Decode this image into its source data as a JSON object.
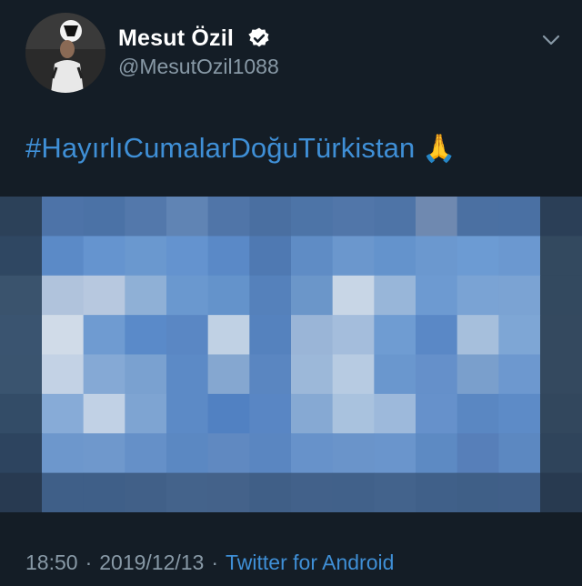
{
  "user": {
    "display_name": "Mesut Özil",
    "handle": "@MesutOzil1088",
    "verified": true
  },
  "tweet": {
    "hashtag": "#HayırlıCumalarDoğuTürkistan",
    "emoji": "🙏"
  },
  "meta": {
    "time": "18:50",
    "separator": "·",
    "date": "2019/12/13",
    "source": "Twitter for Android"
  },
  "icons": {
    "verified": "verified-badge-icon",
    "menu": "chevron-down-icon",
    "emoji": "folded-hands-icon"
  },
  "colors": {
    "background": "#141d26",
    "link": "#3f8fd6",
    "secondary_text": "#8899a6",
    "primary_text": "#ffffff"
  },
  "media": {
    "pixels": [
      [
        "#2c4159",
        "#4d73a8",
        "#4b72a6",
        "#5378ab",
        "#6084b4",
        "#5075a8",
        "#4a6fa1",
        "#4d74a7",
        "#5176a9",
        "#4e74a7",
        "#6f89b0",
        "#4b70a2",
        "#4a70a3",
        "#2b3f57"
      ],
      [
        "#2f4762",
        "#5b8ac7",
        "#6594cf",
        "#6a98cf",
        "#6493cf",
        "#5a89c7",
        "#4f79b2",
        "#5f8cc5",
        "#6b97cd",
        "#6493cc",
        "#6b98cf",
        "#6c9bd3",
        "#6b98d0",
        "#33495f"
      ],
      [
        "#3a536d",
        "#b0c3dc",
        "#b7c8df",
        "#8fb0d6",
        "#6a98cf",
        "#6493cb",
        "#5581bb",
        "#6b96c9",
        "#c8d6e6",
        "#98b6d9",
        "#6d9ad1",
        "#7aa3d4",
        "#7ba3d3",
        "#33495f"
      ],
      [
        "#3a5470",
        "#d0dbe8",
        "#6f9bd1",
        "#5a8ac9",
        "#5a87c4",
        "#c0d1e4",
        "#5582be",
        "#9ab5d7",
        "#a4bddc",
        "#6f9cd2",
        "#5a88c6",
        "#a6bfdc",
        "#7ea6d5",
        "#34495f"
      ],
      [
        "#3a546f",
        "#c3d2e5",
        "#85a9d5",
        "#7aa1d0",
        "#5c8ac6",
        "#85a7d0",
        "#5a86c1",
        "#9cb8d9",
        "#b7cbe2",
        "#6a97ce",
        "#6590ca",
        "#7a9fcc",
        "#6d98cf",
        "#34495f"
      ],
      [
        "#334c67",
        "#87abd7",
        "#c1d1e5",
        "#7ea4d2",
        "#5c8ac6",
        "#5181c2",
        "#5986c4",
        "#86a9d3",
        "#a9c2de",
        "#9db9db",
        "#6691cb",
        "#5a87c2",
        "#5d8bc7",
        "#32475d"
      ],
      [
        "#2d445f",
        "#6d97cc",
        "#6f98cc",
        "#6590c8",
        "#5b88c2",
        "#6089c1",
        "#5a86c1",
        "#6792ca",
        "#6a94ca",
        "#6a95cc",
        "#5d8ac3",
        "#577fb9",
        "#5c88c1",
        "#2f445b"
      ],
      [
        "#283a51",
        "#3f5f88",
        "#3f5f88",
        "#416088",
        "#44638b",
        "#44628a",
        "#405f87",
        "#42618a",
        "#41618a",
        "#43638c",
        "#406089",
        "#3f5f87",
        "#405f88",
        "#283a50"
      ]
    ]
  }
}
